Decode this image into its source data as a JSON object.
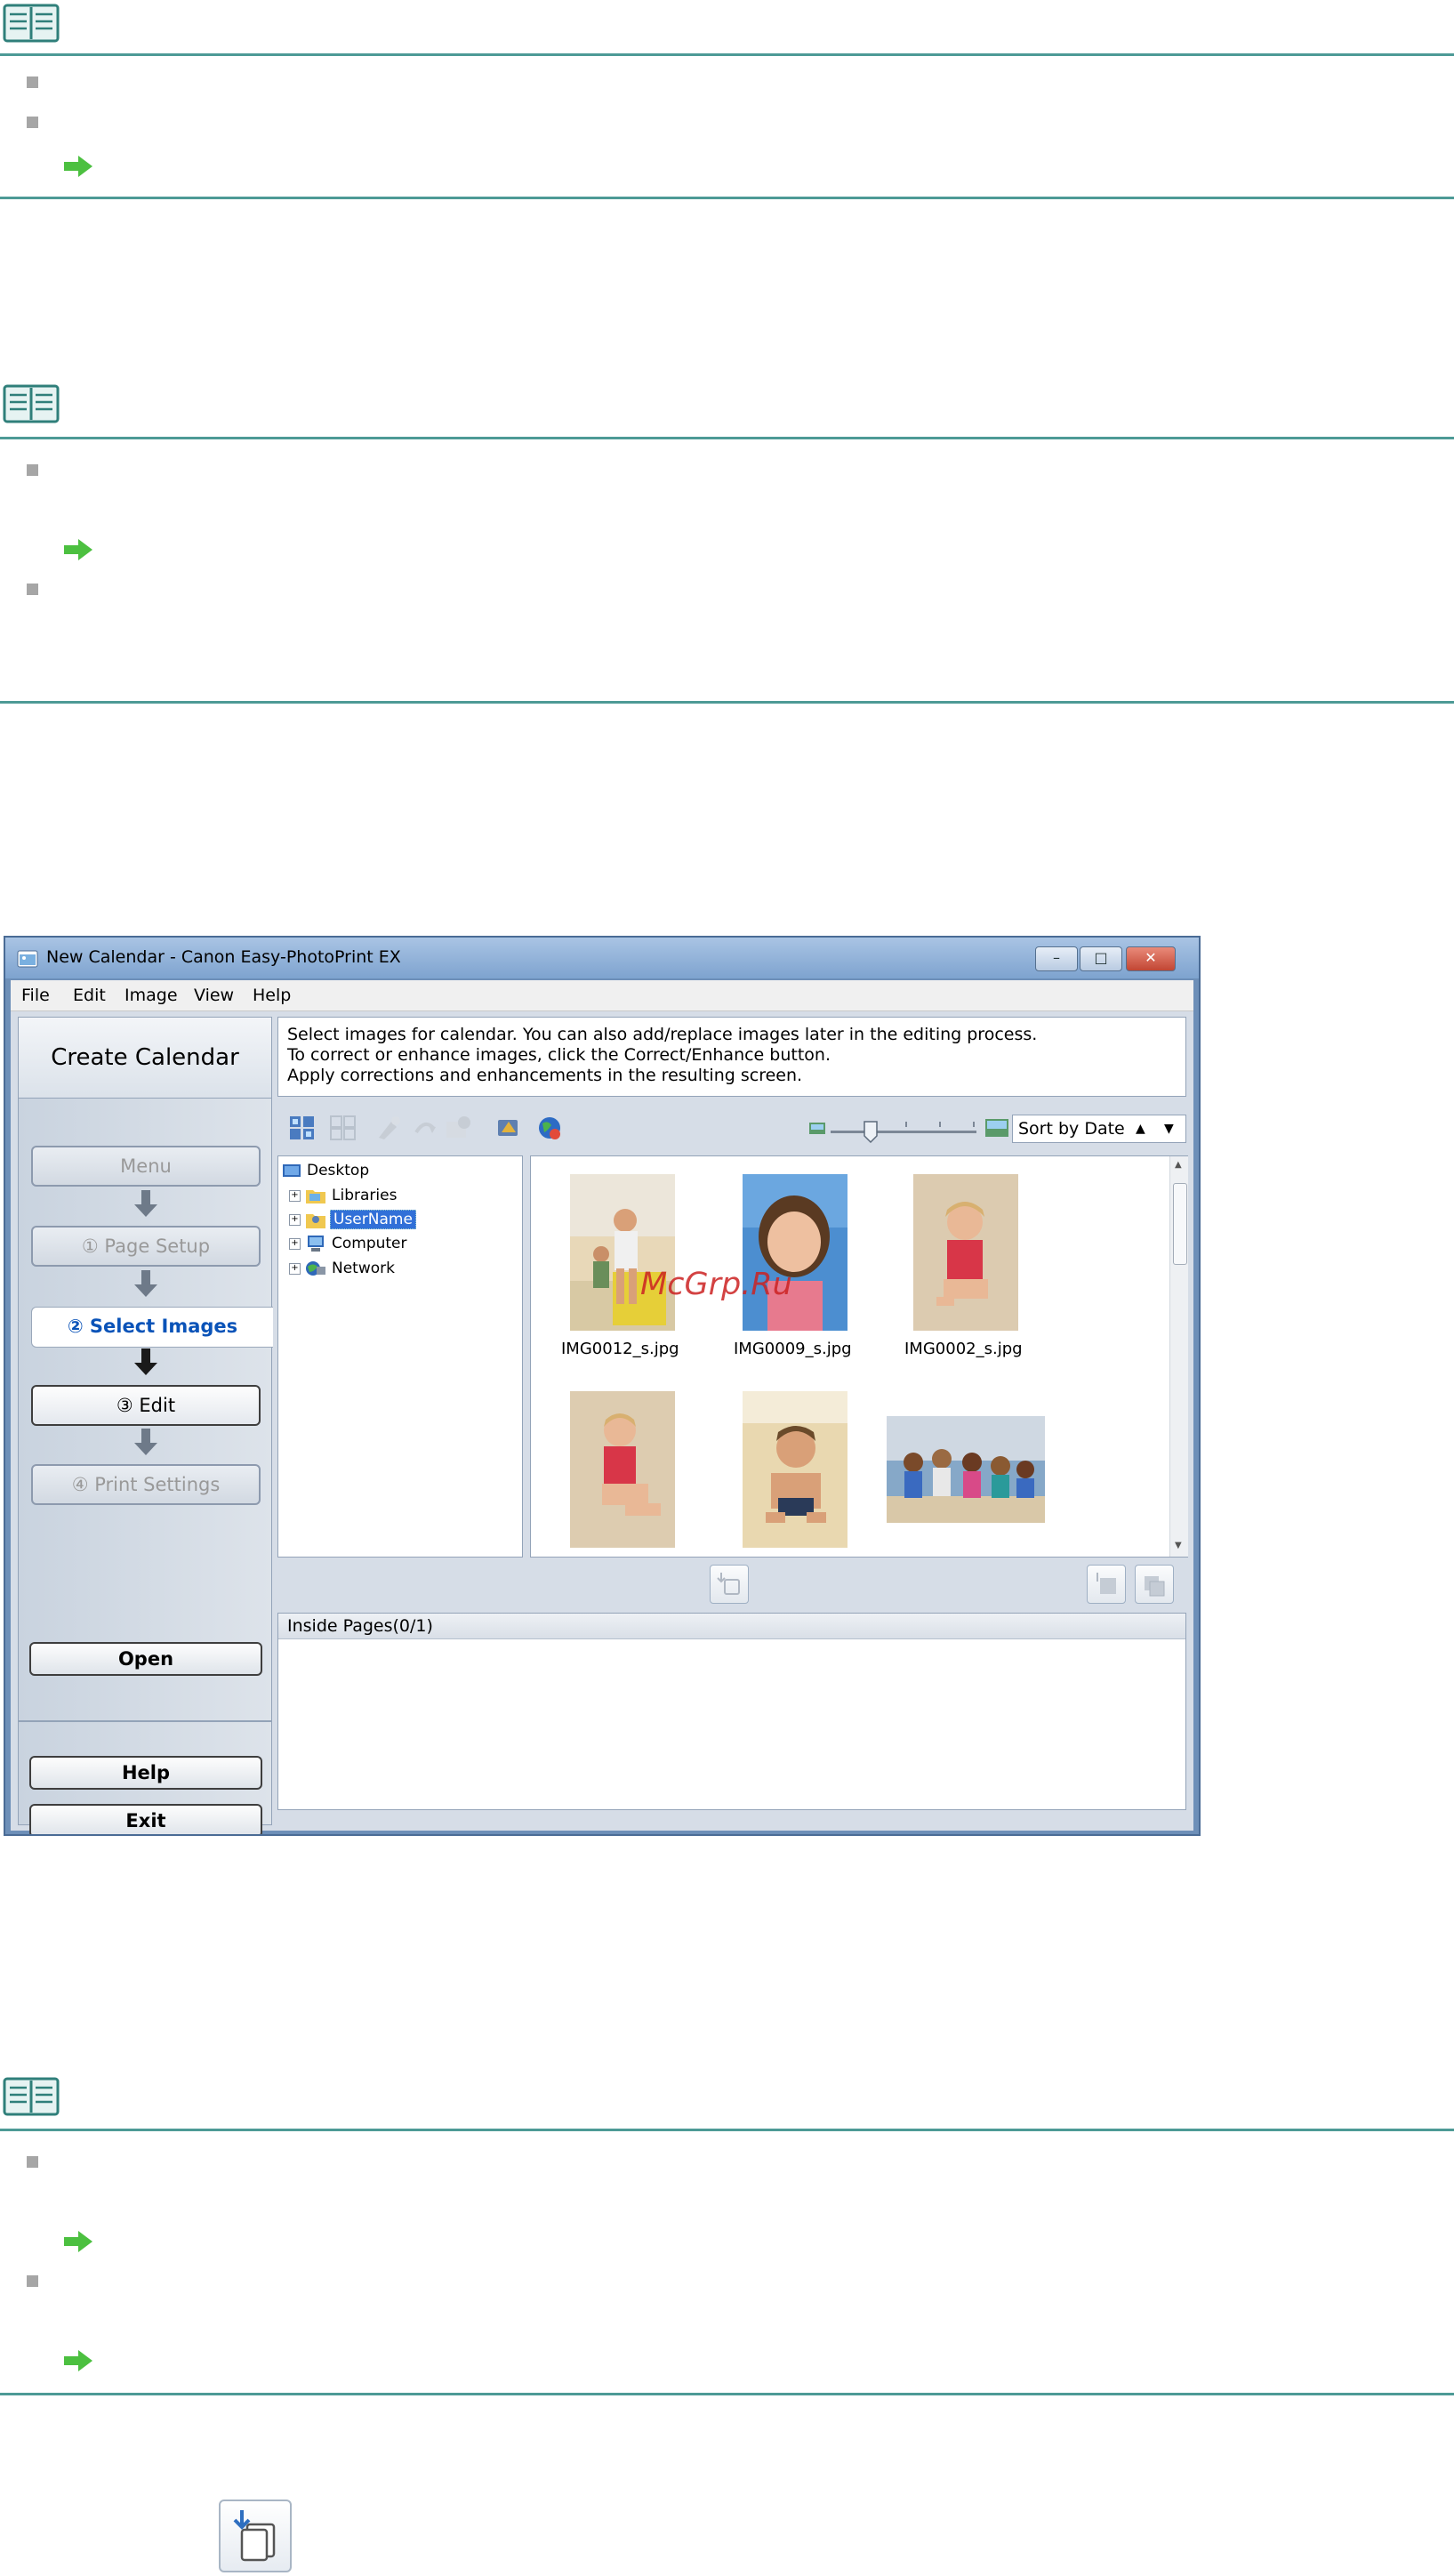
{
  "notes": [
    {
      "icon": "note-book-icon",
      "arrow_count": 1
    },
    {
      "icon": "note-book-icon",
      "arrow_count": 1
    },
    {
      "icon": "note-book-icon",
      "arrow_count": 2
    }
  ],
  "watermark": "McGrp.Ru",
  "window": {
    "title": "New Calendar - Canon Easy-PhotoPrint EX",
    "menu": [
      "File",
      "Edit",
      "Image",
      "View",
      "Help"
    ],
    "left_pane": {
      "title": "Create Calendar",
      "steps": [
        {
          "label": "Menu",
          "state": "disabled"
        },
        {
          "label": "①  Page Setup",
          "state": "disabled"
        },
        {
          "label": "②  Select Images",
          "state": "selected"
        },
        {
          "label": "③        Edit",
          "state": "enabled"
        },
        {
          "label": "④  Print Settings",
          "state": "disabled"
        }
      ],
      "open_label": "Open",
      "help_label": "Help",
      "exit_label": "Exit"
    },
    "instructions": [
      "Select images for calendar. You can also add/replace images later in the editing process.",
      "To correct or enhance images, click the Correct/Enhance button.",
      "Apply corrections and enhancements in the resulting screen."
    ],
    "sort_label": "Sort by Date",
    "zoom_level": 0.25,
    "tree": {
      "root": "Desktop",
      "items": [
        "Libraries",
        "UserName",
        "Computer",
        "Network"
      ],
      "selected": "UserName"
    },
    "thumbnails": [
      {
        "name": "IMG0012_s.jpg"
      },
      {
        "name": "IMG0009_s.jpg"
      },
      {
        "name": "IMG0002_s.jpg"
      },
      {
        "name": ""
      },
      {
        "name": ""
      },
      {
        "name": ""
      }
    ],
    "inside_pages_label": "Inside Pages(0/1)"
  }
}
